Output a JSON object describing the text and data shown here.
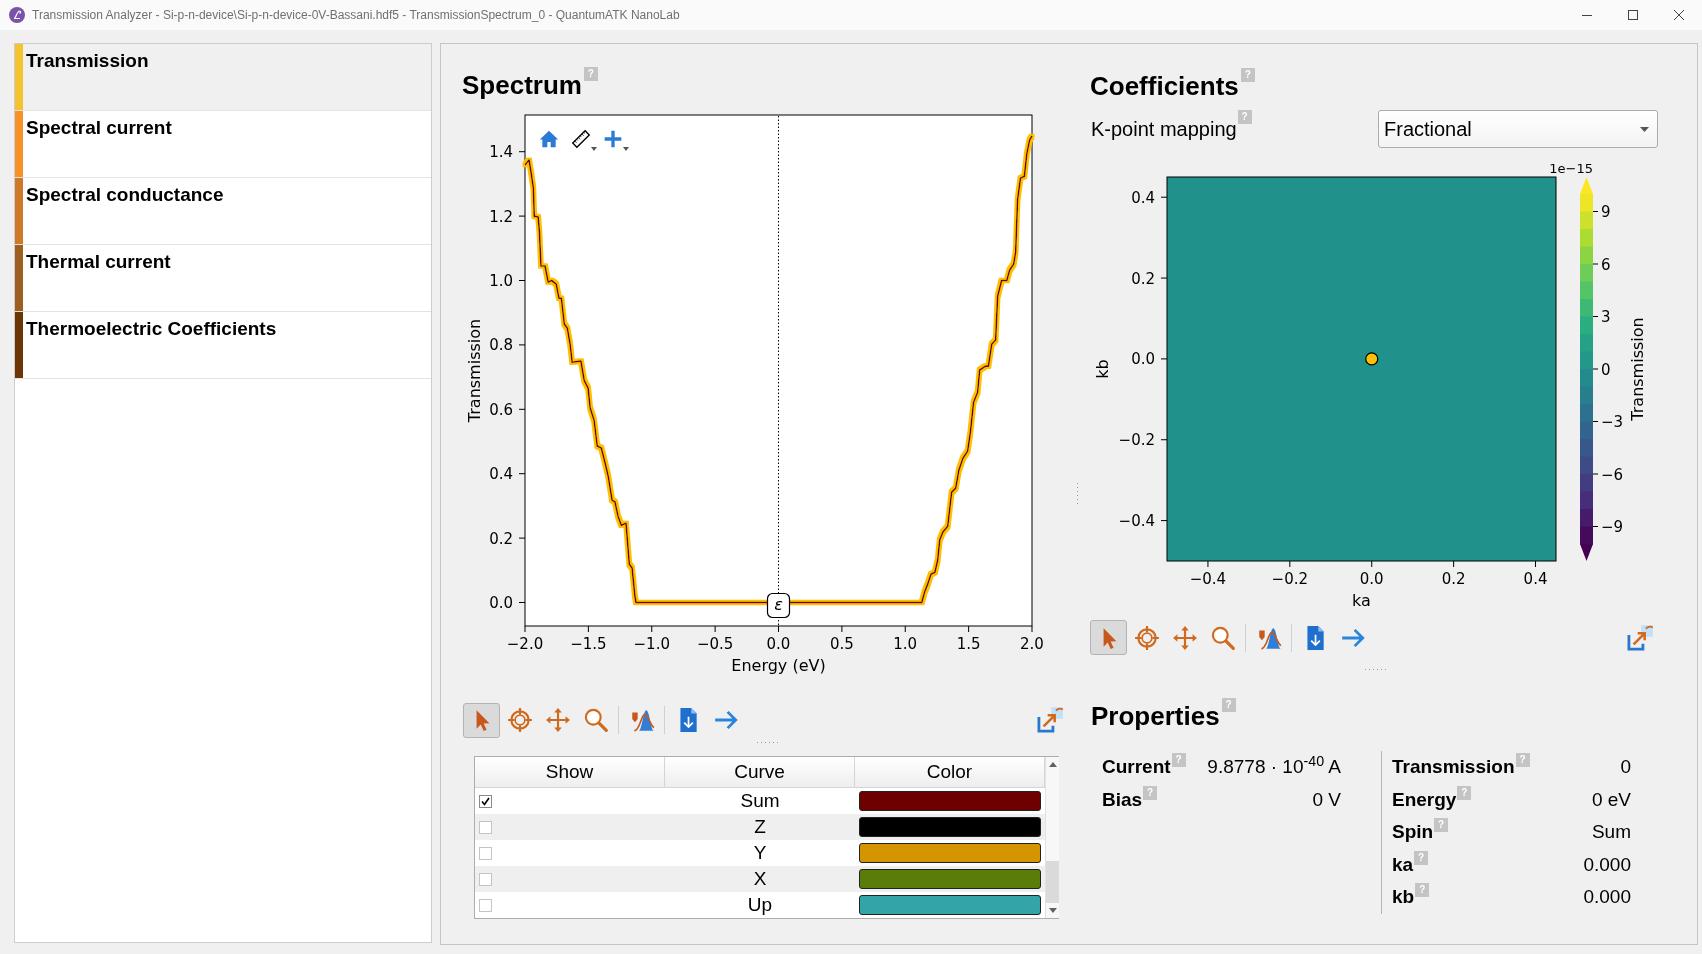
{
  "window": {
    "title": "Transmission Analyzer - Si-p-n-device\\Si-p-n-device-0V-Bassani.hdf5 - TransmissionSpectrum_0 - QuantumATK NanoLab"
  },
  "sidebar": {
    "items": [
      {
        "label": "Transmission",
        "selected": true,
        "color": "#f4c430"
      },
      {
        "label": "Spectral current",
        "selected": false,
        "color": "#f7922a"
      },
      {
        "label": "Spectral conductance",
        "selected": false,
        "color": "#cc7a28"
      },
      {
        "label": "Thermal current",
        "selected": false,
        "color": "#9e5e1f"
      },
      {
        "label": "Thermoelectric Coefficients",
        "selected": false,
        "color": "#6b3505"
      }
    ]
  },
  "spectrum": {
    "title": "Spectrum",
    "help": "?",
    "chart_data": {
      "type": "line",
      "xlabel": "Energy (eV)",
      "ylabel": "Transmission",
      "x": [
        -2.0,
        -1.968,
        -1.95,
        -1.934,
        -1.927,
        -1.896,
        -1.886,
        -1.874,
        -1.842,
        -1.817,
        -1.79,
        -1.754,
        -1.732,
        -1.713,
        -1.69,
        -1.666,
        -1.644,
        -1.628,
        -1.559,
        -1.533,
        -1.502,
        -1.486,
        -1.455,
        -1.43,
        -1.398,
        -1.366,
        -1.344,
        -1.313,
        -1.29,
        -1.266,
        -1.24,
        -1.203,
        -1.177,
        -1.155,
        -1.133,
        -1.124,
        1.13,
        1.152,
        1.177,
        1.203,
        1.234,
        1.256,
        1.272,
        1.297,
        1.335,
        1.366,
        1.398,
        1.423,
        1.455,
        1.492,
        1.514,
        1.539,
        1.571,
        1.587,
        1.634,
        1.656,
        1.682,
        1.713,
        1.729,
        1.76,
        1.801,
        1.823,
        1.855,
        1.871,
        1.886,
        1.909,
        1.94,
        1.959,
        1.981,
        2.0
      ],
      "series": [
        {
          "color": "#6e0000",
          "values": [
            1.359,
            1.374,
            1.33,
            1.287,
            1.2,
            1.197,
            1.15,
            1.045,
            1.045,
            0.995,
            1.0,
            0.989,
            0.945,
            0.945,
            0.865,
            0.852,
            0.802,
            0.746,
            0.75,
            0.69,
            0.666,
            0.604,
            0.566,
            0.486,
            0.48,
            0.43,
            0.393,
            0.318,
            0.312,
            0.268,
            0.24,
            0.246,
            0.119,
            0.107,
            0.02,
            0,
            0,
            0.032,
            0.057,
            0.088,
            0.094,
            0.132,
            0.194,
            0.219,
            0.237,
            0.343,
            0.355,
            0.411,
            0.448,
            0.47,
            0.529,
            0.622,
            0.653,
            0.722,
            0.734,
            0.734,
            0.802,
            0.815,
            0.951,
            1.0,
            1.0,
            1.032,
            1.051,
            1.088,
            1.25,
            1.318,
            1.324,
            1.393,
            1.436,
            1.449
          ]
        }
      ],
      "xlim": [
        -2,
        2
      ],
      "ylim": [
        -0.073,
        1.514
      ],
      "xticks": [
        {
          "value": -2,
          "label": "−2.0"
        },
        {
          "value": -1.5,
          "label": "−1.5"
        },
        {
          "value": -1,
          "label": "−1.0"
        },
        {
          "value": -0.5,
          "label": "−0.5"
        },
        {
          "value": 0,
          "label": "0.0"
        },
        {
          "value": 0.5,
          "label": "0.5"
        },
        {
          "value": 1,
          "label": "1.0"
        },
        {
          "value": 1.5,
          "label": "1.5"
        },
        {
          "value": 2,
          "label": "2.0"
        }
      ],
      "yticks": [
        {
          "value": 0,
          "label": "0.0"
        },
        {
          "value": 0.2,
          "label": "0.2"
        },
        {
          "value": 0.4,
          "label": "0.4"
        },
        {
          "value": 0.6,
          "label": "0.6"
        },
        {
          "value": 0.8,
          "label": "0.8"
        },
        {
          "value": 1,
          "label": "1.0"
        },
        {
          "value": 1.2,
          "label": "1.2"
        },
        {
          "value": 1.4,
          "label": "1.4"
        }
      ],
      "ref_lines": [
        {
          "axis": "x",
          "value": 0,
          "label": "ε"
        }
      ]
    },
    "toolbar": [
      [
        {
          "kind": "select",
          "selected": true
        },
        {
          "kind": "crosshair",
          "selected": false
        },
        {
          "kind": "pan",
          "selected": false
        },
        {
          "kind": "zoom",
          "selected": false
        }
      ],
      [
        {
          "kind": "fit",
          "selected": false
        }
      ],
      [
        {
          "kind": "export",
          "selected": false
        },
        {
          "kind": "next",
          "selected": false
        }
      ]
    ],
    "curves": {
      "columns": [
        "Show",
        "Curve",
        "Color"
      ],
      "rows": [
        {
          "checked": true,
          "curve": "Sum",
          "color": "#6e0000"
        },
        {
          "checked": false,
          "curve": "Z",
          "color": "#000000"
        },
        {
          "checked": false,
          "curve": "Y",
          "color": "#d49500"
        },
        {
          "checked": false,
          "curve": "X",
          "color": "#5a7d0a"
        },
        {
          "checked": false,
          "curve": "Up",
          "color": "#33a5a8"
        }
      ]
    }
  },
  "coefficients": {
    "title": "Coefficients",
    "help": "?",
    "kpoint_mapping": {
      "label": "K-point mapping",
      "help": "?",
      "value": "Fractional"
    },
    "chart_data": {
      "type": "scatter",
      "xlabel": "ka",
      "ylabel": "kb",
      "x": [
        0
      ],
      "series": [
        {
          "color": "#ffc107",
          "values": [
            0
          ]
        }
      ],
      "xlim": [
        -0.5,
        0.45
      ],
      "ylim": [
        -0.5,
        0.45
      ],
      "xticks": [
        {
          "value": -0.4,
          "label": "−0.4"
        },
        {
          "value": -0.2,
          "label": "−0.2"
        },
        {
          "value": 0,
          "label": "0.0"
        },
        {
          "value": 0.2,
          "label": "0.2"
        },
        {
          "value": 0.4,
          "label": "0.4"
        }
      ],
      "yticks": [
        {
          "value": -0.4,
          "label": "−0.4"
        },
        {
          "value": -0.2,
          "label": "−0.2"
        },
        {
          "value": 0,
          "label": "0.0"
        },
        {
          "value": 0.2,
          "label": "0.2"
        },
        {
          "value": 0.4,
          "label": "0.4"
        }
      ]
    },
    "colorbar": {
      "label": "Transmission",
      "offset": "1e−15",
      "ticks": [
        "9",
        "6",
        "3",
        "0",
        "−3",
        "−6",
        "−9"
      ]
    },
    "toolbar": [
      [
        {
          "kind": "select",
          "selected": true
        },
        {
          "kind": "crosshair",
          "selected": false
        },
        {
          "kind": "pan",
          "selected": false
        },
        {
          "kind": "zoom",
          "selected": false
        }
      ],
      [
        {
          "kind": "fit",
          "selected": false
        }
      ],
      [
        {
          "kind": "export",
          "selected": false
        },
        {
          "kind": "next",
          "selected": false
        }
      ]
    ]
  },
  "properties": {
    "title": "Properties",
    "help": "?",
    "left": [
      {
        "label": "Current",
        "help": "?",
        "value": "9.8778 · 10$^{-40}$ A"
      },
      {
        "label": "Bias",
        "help": "?",
        "value": "0 V"
      }
    ],
    "right": [
      {
        "label": "Transmission",
        "help": "?",
        "value": "0"
      },
      {
        "label": "Energy",
        "help": "?",
        "value": "0 eV"
      },
      {
        "label": "Spin",
        "help": "?",
        "value": "Sum"
      },
      {
        "label": "ka",
        "help": "?",
        "value": "0.000"
      },
      {
        "label": "kb",
        "help": "?",
        "value": "0.000"
      }
    ]
  }
}
